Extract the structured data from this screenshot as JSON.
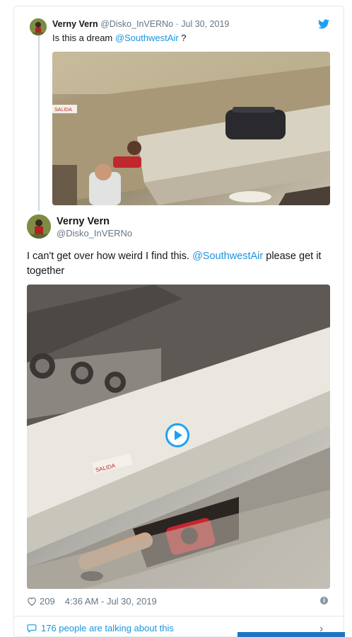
{
  "quoted_tweet": {
    "name": "Verny Vern",
    "handle": "@Disko_InVERNo",
    "separator": "·",
    "date": "Jul 30, 2019",
    "text_before": "Is this a dream ",
    "mention": "@SouthwestAir",
    "text_after": " ?",
    "media_sign": "SALIDA"
  },
  "main_tweet": {
    "name": "Verny Vern",
    "handle": "@Disko_InVERNo",
    "text_before": "I can't get over how weird I find this. ",
    "mention": "@SouthwestAir",
    "text_after": " please get it together",
    "media_sign": "SALIDA"
  },
  "footer": {
    "likes": "209",
    "timestamp": "4:36 AM - Jul 30, 2019",
    "info": "i",
    "talking": "176 people are talking about this"
  },
  "icons": {
    "brand": "twitter-bird-icon",
    "like": "heart-icon",
    "replies": "chat-bubble-icon",
    "play": "play-icon",
    "info": "info-icon",
    "more": "chevron-right-icon"
  },
  "colors": {
    "link": "#1b95e0",
    "twitter_blue": "#1da1f2",
    "secondary_text": "#657786"
  }
}
